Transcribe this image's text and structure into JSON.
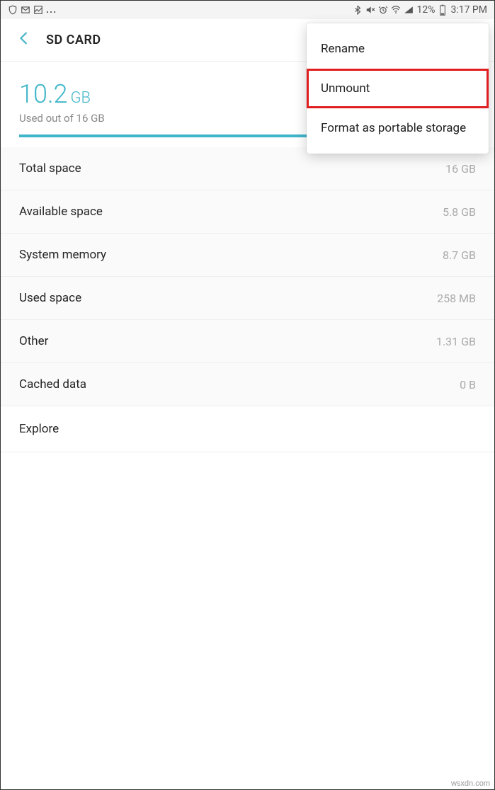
{
  "status_bar": {
    "battery_percent": "12%",
    "time": "3:17 PM",
    "ellipsis": "..."
  },
  "app_bar": {
    "title": "SD CARD"
  },
  "summary": {
    "used_value": "10.2",
    "used_unit": "GB",
    "used_caption": "Used out of 16 GB"
  },
  "rows": [
    {
      "label": "Total space",
      "value": "16 GB"
    },
    {
      "label": "Available space",
      "value": "5.8 GB"
    },
    {
      "label": "System memory",
      "value": "8.7 GB"
    },
    {
      "label": "Used space",
      "value": "258 MB"
    },
    {
      "label": "Other",
      "value": "1.31 GB"
    },
    {
      "label": "Cached data",
      "value": "0 B"
    }
  ],
  "explore": {
    "label": "Explore"
  },
  "menu": {
    "items": [
      {
        "label": "Rename"
      },
      {
        "label": "Unmount"
      },
      {
        "label": "Format as portable storage"
      }
    ]
  },
  "watermark": "wsxdn.com"
}
